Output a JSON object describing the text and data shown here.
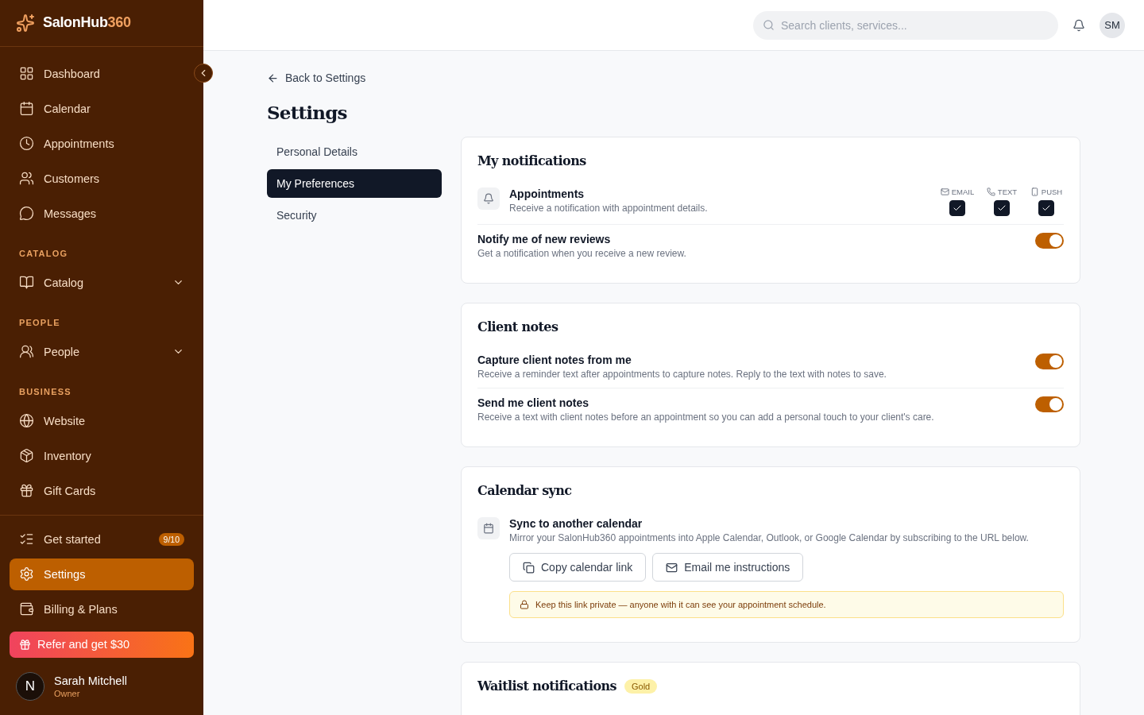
{
  "brand": {
    "name": "SalonHub",
    "suffix": "360"
  },
  "sidebar": {
    "groups": [
      {
        "items": [
          {
            "label": "Dashboard",
            "selected": false
          },
          {
            "label": "Calendar",
            "selected": false
          },
          {
            "label": "Appointments",
            "selected": false
          },
          {
            "label": "Customers",
            "selected": false
          },
          {
            "label": "Messages",
            "selected": false
          }
        ]
      },
      {
        "heading": "CATALOG",
        "items": [
          {
            "label": "Catalog",
            "selected": false,
            "expanded": false
          }
        ]
      },
      {
        "heading": "PEOPLE",
        "items": [
          {
            "label": "People",
            "selected": false,
            "expanded": false
          }
        ]
      },
      {
        "heading": "BUSINESS",
        "items": [
          {
            "label": "Website",
            "selected": false
          },
          {
            "label": "Inventory",
            "selected": false
          },
          {
            "label": "Gift Cards",
            "selected": false
          }
        ]
      }
    ],
    "bottom_items": [
      {
        "label": "Get started",
        "badge": "9/10",
        "selected": false
      },
      {
        "label": "Settings",
        "selected": true
      },
      {
        "label": "Billing & Plans",
        "selected": false
      }
    ],
    "refer_button": "Refer and get $30",
    "user": {
      "initial": "N",
      "name": "Sarah Mitchell",
      "role": "Owner"
    }
  },
  "topbar": {
    "search": {
      "placeholder": "Search clients, services..."
    },
    "avatar": "SM"
  },
  "back_link": "Back to Settings",
  "page_title": "Settings",
  "settings_nav": [
    {
      "label": "Personal Details",
      "selected": false
    },
    {
      "label": "My Preferences",
      "selected": true
    },
    {
      "label": "Security",
      "selected": false
    }
  ],
  "cards": [
    {
      "title": "My notifications",
      "rows": [
        {
          "kind": "channels",
          "title": "Appointments",
          "description": "Receive a notification with appointment details.",
          "channels": [
            {
              "label": "EMAIL",
              "checked": true
            },
            {
              "label": "TEXT",
              "checked": true
            },
            {
              "label": "PUSH",
              "checked": true
            }
          ]
        },
        {
          "kind": "toggle",
          "title": "Notify me of new reviews",
          "description": "Get a notification when you receive a new review.",
          "on": true
        }
      ]
    },
    {
      "title": "Client notes",
      "rows": [
        {
          "kind": "toggle",
          "title": "Capture client notes from me",
          "description": "Receive a reminder text after appointments to capture notes. Reply to the text with notes to save.",
          "on": true
        },
        {
          "kind": "toggle",
          "title": "Send me client notes",
          "description": "Receive a text with client notes before an appointment so you can add a personal touch to your client's care.",
          "on": true
        }
      ]
    },
    {
      "title": "Calendar sync",
      "rows": [
        {
          "kind": "sync",
          "title": "Sync to another calendar",
          "description": "Mirror your SalonHub360 appointments into Apple Calendar, Outlook, or Google Calendar by subscribing to the URL below.",
          "buttons": [
            "Copy calendar link",
            "Email me instructions"
          ],
          "notice": "Keep this link private — anyone with it can see your appointment schedule."
        }
      ]
    },
    {
      "title": "Waitlist notifications",
      "badge": "Gold"
    }
  ]
}
